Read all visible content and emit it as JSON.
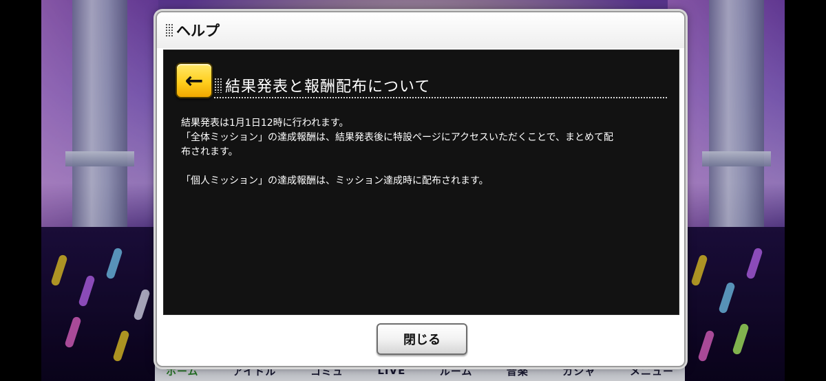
{
  "dialog": {
    "title": "ヘルプ",
    "back_icon": "arrow-left-icon",
    "section_title": "結果発表と報酬配布について",
    "paragraphs": [
      "結果発表は1月1日12時に行われます。",
      "「全体ミッション」の達成報酬は、結果発表後に特設ページにアクセスいただくことで、まとめて配",
      "布されます。",
      "",
      "「個人ミッション」の達成報酬は、ミッション達成時に配布されます。"
    ],
    "close_label": "閉じる"
  },
  "bottom_nav": {
    "items": [
      {
        "label": "ホーム",
        "active": true
      },
      {
        "label": "アイドル",
        "active": false
      },
      {
        "label": "コミュ",
        "active": false
      },
      {
        "label": "LIVE",
        "active": false
      },
      {
        "label": "ルーム",
        "active": false
      },
      {
        "label": "音楽",
        "active": false
      },
      {
        "label": "ガシャ",
        "active": false
      },
      {
        "label": "メニュー",
        "active": false
      }
    ]
  },
  "colors": {
    "accent_yellow": "#ffcf1e",
    "content_background": "#121212",
    "dialog_background": "#ffffff",
    "nav_active": "#2f8a2f"
  }
}
